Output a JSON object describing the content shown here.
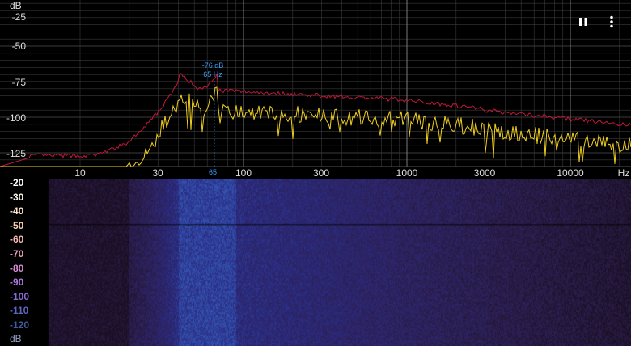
{
  "spectrum": {
    "unit_label": "dB",
    "y_ticks": [
      "-25",
      "-50",
      "-75",
      "-100",
      "-125"
    ],
    "x_ticks": [
      "10",
      "30",
      "100",
      "300",
      "1000",
      "3000",
      "10000",
      "Hz"
    ],
    "peak": {
      "level_label": "-76 dB",
      "freq_label": "65 Hz",
      "axis_marker": "65"
    }
  },
  "colors": {
    "peak_hold": "#c0183a",
    "live": "#f0d020",
    "peak_marker": "#3aa0ff",
    "grid": "#3a3a3a",
    "grid_major": "#777777"
  },
  "controls": {
    "pause_icon": "pause-icon",
    "menu_icon": "more-vert-icon"
  },
  "spectrogram": {
    "unit_label": "dB",
    "scale_ticks": [
      {
        "label": "-20",
        "color": "#ffffff"
      },
      {
        "label": "-30",
        "color": "#fff6e8"
      },
      {
        "label": "-40",
        "color": "#ffe6cc"
      },
      {
        "label": "-50",
        "color": "#ffd2b0"
      },
      {
        "label": "-60",
        "color": "#f8b8b0"
      },
      {
        "label": "-70",
        "color": "#f0a0c0"
      },
      {
        "label": "-80",
        "color": "#d88cd8"
      },
      {
        "label": "-90",
        "color": "#b07ae0"
      },
      {
        "label": "-100",
        "color": "#8a6ad8"
      },
      {
        "label": "-110",
        "color": "#5e66c0"
      },
      {
        "label": "-120",
        "color": "#3c5c9c"
      }
    ]
  }
}
